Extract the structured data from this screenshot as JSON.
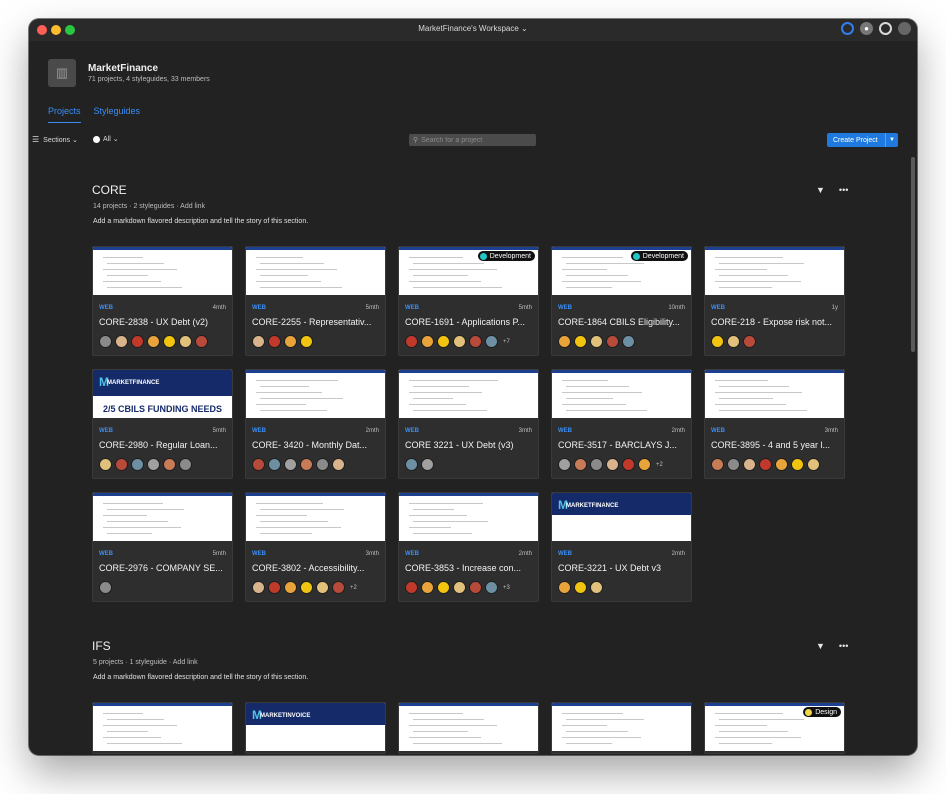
{
  "window": {
    "title": "MarketFinance's Workspace ⌄"
  },
  "workspace": {
    "name": "MarketFinance",
    "meta": "71 projects, 4 styleguides, 33 members",
    "logo_icon": "building-icon"
  },
  "tabs": [
    {
      "label": "Projects",
      "active": true
    },
    {
      "label": "Styleguides",
      "active": false
    }
  ],
  "toolbar": {
    "sections_label": "Sections ⌄",
    "filter_label": "All ⌄",
    "search_placeholder": "Search for a project",
    "create_label": "Create Project"
  },
  "sections": [
    {
      "title": "CORE",
      "meta": "14 projects  ·  2 styleguides  ·  Add link",
      "description": "Add a markdown flavored description and tell the story of this section.",
      "projects": [
        {
          "type": "WEB",
          "time": "4mth",
          "name": "CORE-2838 - UX Debt (v2)",
          "avatars": 7,
          "more": "",
          "badge": ""
        },
        {
          "type": "WEB",
          "time": "5mth",
          "name": "CORE-2255 - Representativ...",
          "avatars": 4,
          "more": "",
          "badge": ""
        },
        {
          "type": "WEB",
          "time": "5mth",
          "name": "CORE-1691 - Applications P...",
          "avatars": 6,
          "more": "+7",
          "badge": "Development"
        },
        {
          "type": "WEB",
          "time": "10mth",
          "name": "CORE-1864 CBILS Eligibility...",
          "avatars": 5,
          "more": "",
          "badge": "Development"
        },
        {
          "type": "WEB",
          "time": "1y",
          "name": "CORE-218 - Expose risk not...",
          "avatars": 3,
          "more": "",
          "badge": ""
        },
        {
          "type": "WEB",
          "time": "5mth",
          "name": "CORE-2980 - Regular Loan...",
          "avatars": 6,
          "more": "",
          "badge": "",
          "thumb_heading": "2/5 CBILS FUNDING NEEDS",
          "thumb_logo": "MARKETFINANCE"
        },
        {
          "type": "WEB",
          "time": "2mth",
          "name": "CORE- 3420 - Monthly Dat...",
          "avatars": 6,
          "more": "",
          "badge": ""
        },
        {
          "type": "WEB",
          "time": "3mth",
          "name": "CORE 3221 - UX Debt (v3)",
          "avatars": 2,
          "more": "",
          "badge": ""
        },
        {
          "type": "WEB",
          "time": "2mth",
          "name": "CORE-3517 - BARCLAYS J...",
          "avatars": 6,
          "more": "+2",
          "badge": ""
        },
        {
          "type": "WEB",
          "time": "3mth",
          "name": "CORE-3895 - 4 and 5 year l...",
          "avatars": 7,
          "more": "",
          "badge": ""
        },
        {
          "type": "WEB",
          "time": "5mth",
          "name": "CORE-2976 - COMPANY SE...",
          "avatars": 1,
          "more": "",
          "badge": ""
        },
        {
          "type": "WEB",
          "time": "3mth",
          "name": "CORE-3802 - Accessibility...",
          "avatars": 6,
          "more": "+2",
          "badge": ""
        },
        {
          "type": "WEB",
          "time": "2mth",
          "name": "CORE-3853 - Increase con...",
          "avatars": 6,
          "more": "+3",
          "badge": ""
        },
        {
          "type": "WEB",
          "time": "2mth",
          "name": "CORE-3221 - UX Debt v3",
          "avatars": 3,
          "more": "",
          "badge": "",
          "thumb_logo": "MARKETFINANCE"
        }
      ]
    },
    {
      "title": "IFS",
      "meta": "5 projects  ·  1 styleguide  ·  Add link",
      "description": "Add a markdown flavored description and tell the story of this section.",
      "projects": [
        {
          "badge": ""
        },
        {
          "badge": "",
          "thumb_logo": "MARKETINVOICE"
        },
        {
          "badge": ""
        },
        {
          "badge": ""
        },
        {
          "badge": "Design"
        }
      ]
    }
  ],
  "colors": {
    "accent": "#3b8ef5",
    "button": "#1f7ae0",
    "background": "#222222",
    "card": "#2e2e2e",
    "dev_badge_dot": "#23c6c6",
    "design_badge_dot": "#f2d64b"
  }
}
